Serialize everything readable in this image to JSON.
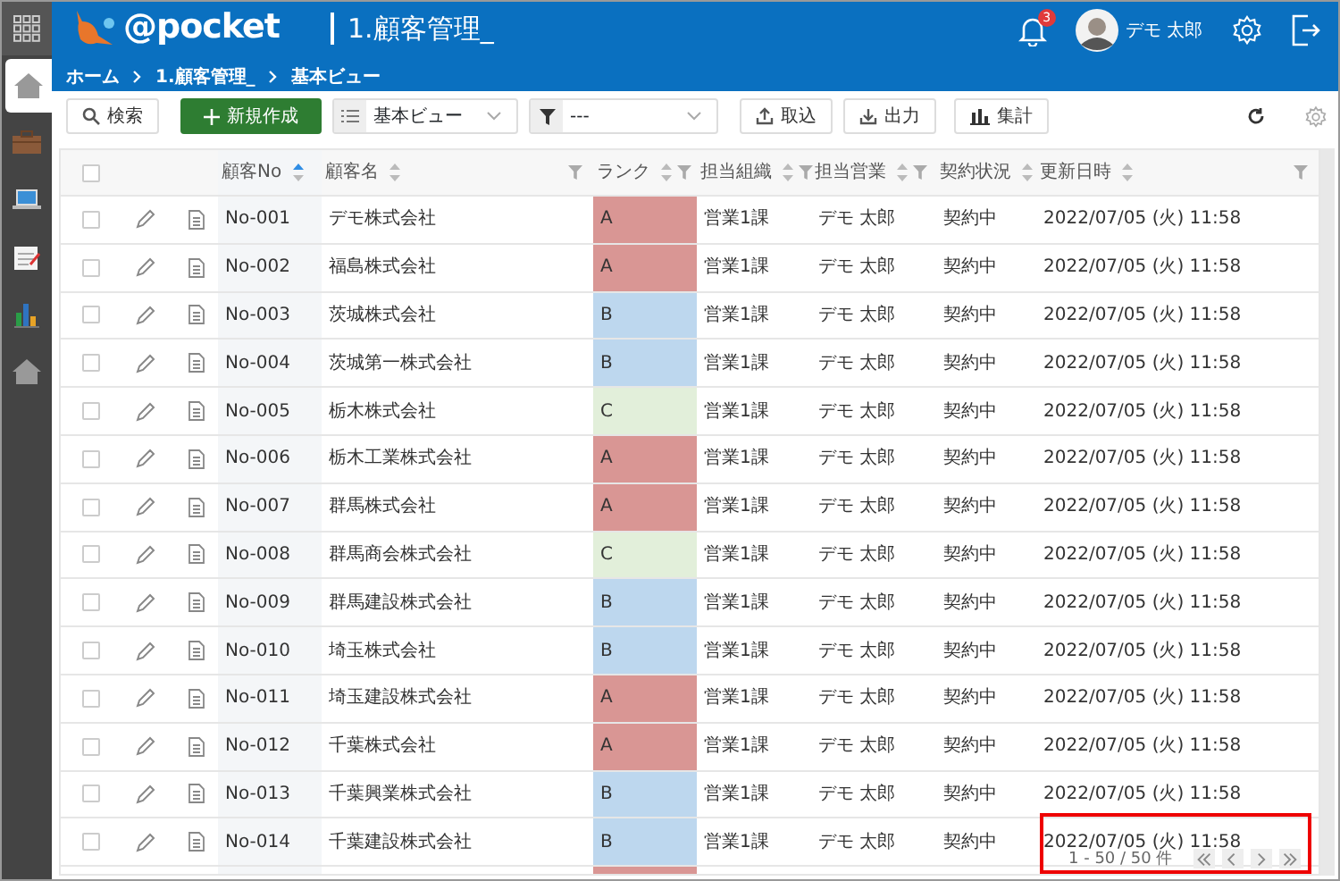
{
  "sidebar": {
    "items": [
      {
        "kind": "apps",
        "selected": false
      },
      {
        "kind": "home",
        "selected": true
      },
      {
        "kind": "briefcase",
        "selected": false
      },
      {
        "kind": "laptop",
        "selected": false
      },
      {
        "kind": "notepad",
        "selected": false
      },
      {
        "kind": "chart",
        "selected": false
      },
      {
        "kind": "home",
        "selected": false
      }
    ]
  },
  "header": {
    "logo_text": "@pocket",
    "title": "1.顧客管理_",
    "breadcrumb": [
      "ホーム",
      "1.顧客管理_",
      "基本ビュー"
    ],
    "notification_count": "3",
    "user_name": "デモ 太郎"
  },
  "toolbar": {
    "search_label": "検索",
    "create_label": "新規作成",
    "view_select": "基本ビュー",
    "filter_select": "---",
    "import_label": "取込",
    "export_label": "出力",
    "aggregate_label": "集計"
  },
  "table": {
    "select_all_checked": false,
    "columns": [
      {
        "label": "顧客No",
        "sorted": true,
        "filter": false
      },
      {
        "label": "顧客名",
        "sorted": false,
        "filter": true
      },
      {
        "label": "ランク",
        "sorted": false,
        "filter": true
      },
      {
        "label": "担当組織",
        "sorted": false,
        "filter": true
      },
      {
        "label": "担当営業",
        "sorted": false,
        "filter": true
      },
      {
        "label": "契約状況",
        "sorted": false,
        "filter": false
      },
      {
        "label": "更新日時",
        "sorted": false,
        "filter": true
      }
    ],
    "rows": [
      {
        "checked": false,
        "no": "No-001",
        "name": "デモ株式会社",
        "rank": "A",
        "color": "#d99694",
        "org": "営業1課",
        "rep": "デモ 太郎",
        "status": "契約中",
        "updated": "2022/07/05 (火) 11:58"
      },
      {
        "checked": false,
        "no": "No-002",
        "name": "福島株式会社",
        "rank": "A",
        "color": "#d99694",
        "org": "営業1課",
        "rep": "デモ 太郎",
        "status": "契約中",
        "updated": "2022/07/05 (火) 11:58"
      },
      {
        "checked": false,
        "no": "No-003",
        "name": "茨城株式会社",
        "rank": "B",
        "color": "#bdd7ee",
        "org": "営業1課",
        "rep": "デモ 太郎",
        "status": "契約中",
        "updated": "2022/07/05 (火) 11:58"
      },
      {
        "checked": false,
        "no": "No-004",
        "name": "茨城第一株式会社",
        "rank": "B",
        "color": "#bdd7ee",
        "org": "営業1課",
        "rep": "デモ 太郎",
        "status": "契約中",
        "updated": "2022/07/05 (火) 11:58"
      },
      {
        "checked": false,
        "no": "No-005",
        "name": "栃木株式会社",
        "rank": "C",
        "color": "#e2efda",
        "org": "営業1課",
        "rep": "デモ 太郎",
        "status": "契約中",
        "updated": "2022/07/05 (火) 11:58"
      },
      {
        "checked": false,
        "no": "No-006",
        "name": "栃木工業株式会社",
        "rank": "A",
        "color": "#d99694",
        "org": "営業1課",
        "rep": "デモ 太郎",
        "status": "契約中",
        "updated": "2022/07/05 (火) 11:58"
      },
      {
        "checked": false,
        "no": "No-007",
        "name": "群馬株式会社",
        "rank": "A",
        "color": "#d99694",
        "org": "営業1課",
        "rep": "デモ 太郎",
        "status": "契約中",
        "updated": "2022/07/05 (火) 11:58"
      },
      {
        "checked": false,
        "no": "No-008",
        "name": "群馬商会株式会社",
        "rank": "C",
        "color": "#e2efda",
        "org": "営業1課",
        "rep": "デモ 太郎",
        "status": "契約中",
        "updated": "2022/07/05 (火) 11:58"
      },
      {
        "checked": false,
        "no": "No-009",
        "name": "群馬建設株式会社",
        "rank": "B",
        "color": "#bdd7ee",
        "org": "営業1課",
        "rep": "デモ 太郎",
        "status": "契約中",
        "updated": "2022/07/05 (火) 11:58"
      },
      {
        "checked": false,
        "no": "No-010",
        "name": "埼玉株式会社",
        "rank": "B",
        "color": "#bdd7ee",
        "org": "営業1課",
        "rep": "デモ 太郎",
        "status": "契約中",
        "updated": "2022/07/05 (火) 11:58"
      },
      {
        "checked": false,
        "no": "No-011",
        "name": "埼玉建設株式会社",
        "rank": "A",
        "color": "#d99694",
        "org": "営業1課",
        "rep": "デモ 太郎",
        "status": "契約中",
        "updated": "2022/07/05 (火) 11:58"
      },
      {
        "checked": false,
        "no": "No-012",
        "name": "千葉株式会社",
        "rank": "A",
        "color": "#d99694",
        "org": "営業1課",
        "rep": "デモ 太郎",
        "status": "契約中",
        "updated": "2022/07/05 (火) 11:58"
      },
      {
        "checked": false,
        "no": "No-013",
        "name": "千葉興業株式会社",
        "rank": "B",
        "color": "#bdd7ee",
        "org": "営業1課",
        "rep": "デモ 太郎",
        "status": "契約中",
        "updated": "2022/07/05 (火) 11:58"
      },
      {
        "checked": false,
        "no": "No-014",
        "name": "千葉建設株式会社",
        "rank": "B",
        "color": "#bdd7ee",
        "org": "営業1課",
        "rep": "デモ 太郎",
        "status": "契約中",
        "updated": "2022/07/05 (火) 11:58"
      },
      {
        "color": "#d99694"
      }
    ]
  },
  "pagination": {
    "summary": "1 - 50 / 50 件"
  }
}
